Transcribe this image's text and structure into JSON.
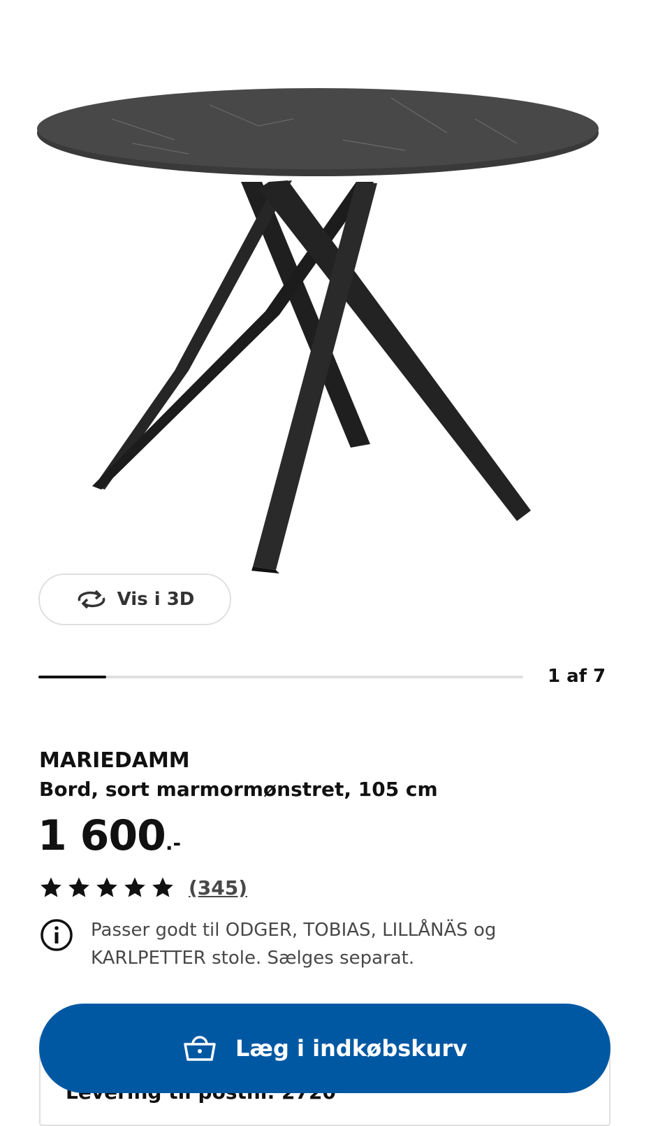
{
  "gallery": {
    "image_alt": "",
    "view_3d_label": "Vis i 3D",
    "counter_text": "1 af 7",
    "progress": 0.14
  },
  "product": {
    "name": "MARIEDAMM",
    "description": "Bord, sort marmormønstret, 105 cm",
    "price": "1 600",
    "price_suffix": ".-",
    "rating": 5,
    "review_count": "(345)"
  },
  "info": {
    "text": "Passer godt til ODGER, TOBIAS, LILLÅNÄS og KARLPETTER stole. Sælges separat."
  },
  "cart": {
    "button_label": "Læg i indkøbskurv"
  },
  "delivery": {
    "label": "Levering til postnr. 2720"
  },
  "colors": {
    "primary": "#0058a3",
    "text": "#111111",
    "muted": "#484848",
    "border": "#dfdfdf"
  },
  "icons": {
    "rotate": "rotate-3d-icon",
    "star": "star-icon",
    "info": "info-icon",
    "basket": "basket-icon"
  }
}
